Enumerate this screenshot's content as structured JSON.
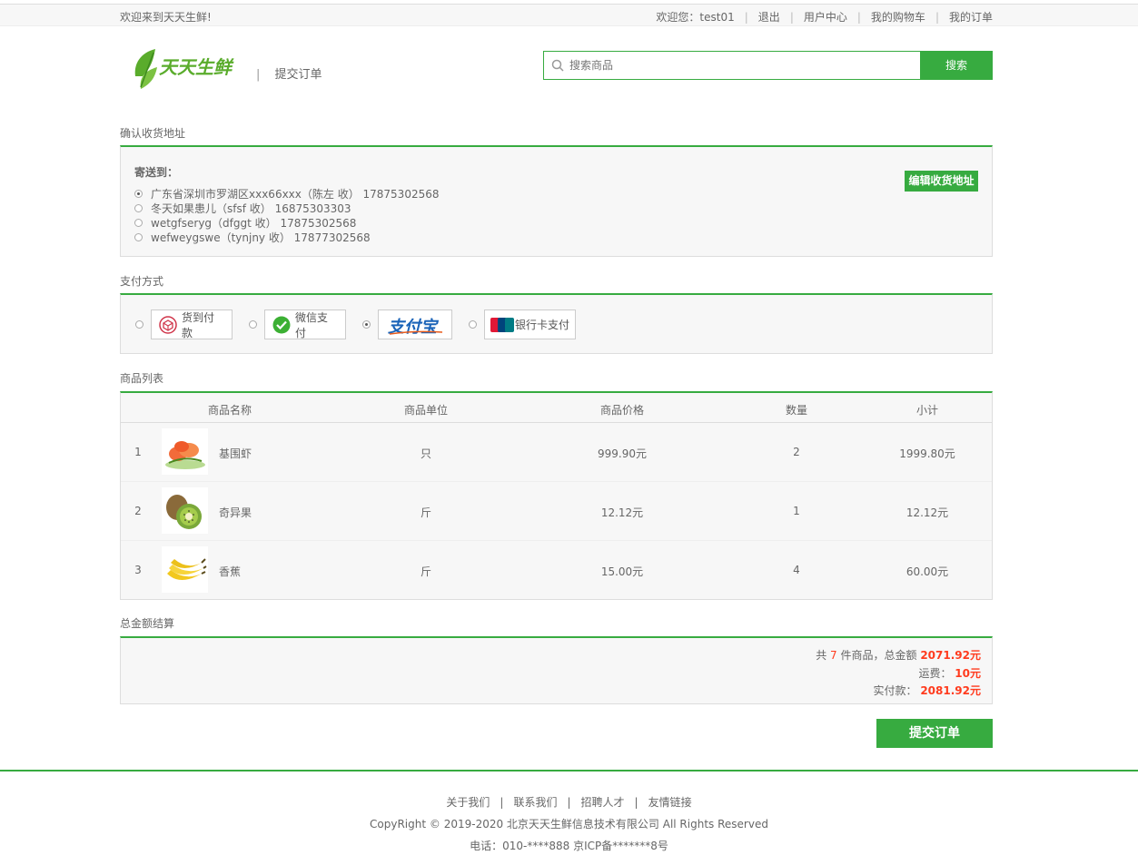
{
  "topbar": {
    "welcome": "欢迎来到天天生鲜!",
    "user_greeting": "欢迎您：test01",
    "logout": "退出",
    "user_center": "用户中心",
    "cart": "我的购物车",
    "orders": "我的订单"
  },
  "header": {
    "logo_text": "天天生鲜",
    "page_title": "提交订单",
    "search_placeholder": "搜索商品",
    "search_button": "搜索"
  },
  "address": {
    "section_title": "确认收货地址",
    "label": "寄送到：",
    "edit_button": "编辑收货地址",
    "items": [
      {
        "text": "广东省深圳市罗湖区xxx66xxx（陈左 收） 17875302568",
        "selected": true
      },
      {
        "text": "冬天如果患儿（sfsf 收） 16875303303",
        "selected": false
      },
      {
        "text": "wetgfseryg（dfggt 收） 17875302568",
        "selected": false
      },
      {
        "text": "wefweygswe（tynjny 收） 17877302568",
        "selected": false
      }
    ]
  },
  "payment": {
    "section_title": "支付方式",
    "options": [
      {
        "label": "货到付款",
        "icon": "cash-on-delivery-icon",
        "selected": false
      },
      {
        "label": "微信支付",
        "icon": "wechat-pay-icon",
        "selected": false
      },
      {
        "label": "",
        "icon": "alipay-logo",
        "logo_text": "支付宝",
        "selected": true
      },
      {
        "label": "银行卡支付",
        "icon": "unionpay-icon",
        "selected": false
      }
    ]
  },
  "goods": {
    "section_title": "商品列表",
    "headers": [
      "商品名称",
      "商品单位",
      "商品价格",
      "数量",
      "小计"
    ],
    "rows": [
      {
        "index": "1",
        "name": "基围虾",
        "unit": "只",
        "price": "999.90元",
        "qty": "2",
        "subtotal": "1999.80元",
        "image": "shrimp-image"
      },
      {
        "index": "2",
        "name": "奇异果",
        "unit": "斤",
        "price": "12.12元",
        "qty": "1",
        "subtotal": "12.12元",
        "image": "kiwi-image"
      },
      {
        "index": "3",
        "name": "香蕉",
        "unit": "斤",
        "price": "15.00元",
        "qty": "4",
        "subtotal": "60.00元",
        "image": "banana-image"
      }
    ]
  },
  "total": {
    "section_title": "总金额结算",
    "count_prefix": "共 ",
    "count": "7",
    "count_suffix": " 件商品，总金额 ",
    "amount": "2071.92元",
    "freight_label": "运费： ",
    "freight": "10元",
    "pay_label": "实付款： ",
    "pay_amount": "2081.92元"
  },
  "submit_button": "提交订单",
  "footer": {
    "links": [
      "关于我们",
      "联系我们",
      "招聘人才",
      "友情链接"
    ],
    "copyright": "CopyRight © 2019-2020 北京天天生鲜信息技术有限公司 All Rights Reserved",
    "tel": "电话：010-****888 京ICP备*******8号"
  },
  "colors": {
    "accent": "#37ab40",
    "price": "#ff3b1e"
  }
}
